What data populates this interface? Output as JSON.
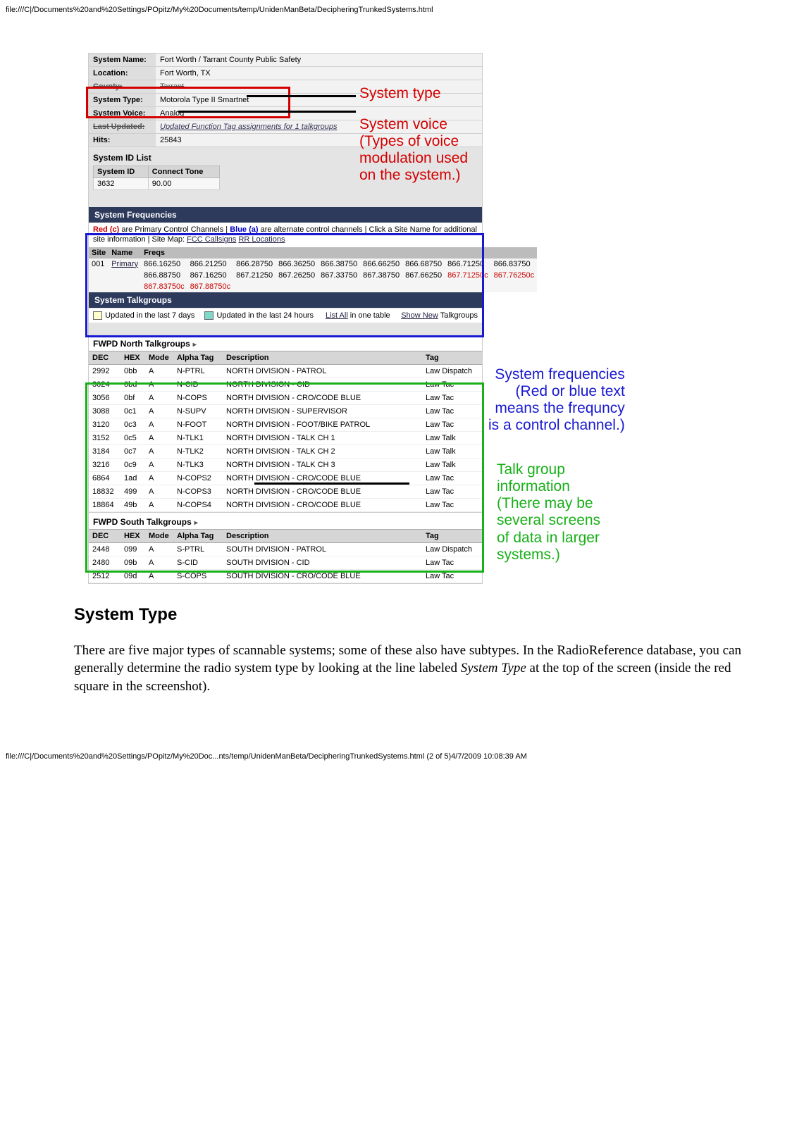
{
  "page": {
    "url_top": "file:///C|/Documents%20and%20Settings/POpitz/My%20Documents/temp/UnidenManBeta/DecipheringTrunkedSystems.html",
    "url_bottom": "file:///C|/Documents%20and%20Settings/POpitz/My%20Doc...nts/temp/UnidenManBeta/DecipheringTrunkedSystems.html (2 of 5)4/7/2009 10:08:39 AM"
  },
  "sysinfo": {
    "rows": [
      {
        "label": "System Name:",
        "value": "Fort Worth / Tarrant County Public Safety"
      },
      {
        "label": "Location:",
        "value": "Fort Worth, TX"
      },
      {
        "label": "County:",
        "value": "Tarrant",
        "struck": true
      },
      {
        "label": "System Type:",
        "value": "Motorola Type II Smartnet"
      },
      {
        "label": "System Voice:",
        "value": "Analog"
      },
      {
        "label": "Last Updated:",
        "value": "Updated Function Tag assignments for 1 talkgroups",
        "italic": true
      },
      {
        "label": "Hits:",
        "value": "25843"
      }
    ]
  },
  "sysid": {
    "heading": "System ID List",
    "headers": [
      "System ID",
      "Connect Tone"
    ],
    "row": [
      "3632",
      "90.00"
    ]
  },
  "freqs": {
    "bar": "System Frequencies",
    "legend_red": "Red (c)",
    "legend_red_rest": " are Primary Control Channels | ",
    "legend_blue": "Blue (a)",
    "legend_blue_rest": " are alternate control channels | Click a Site Name for additional site information | Site Map: ",
    "legend_link1": "FCC Callsigns",
    "legend_link2": "RR Locations",
    "headers": [
      "Site",
      "Name",
      "Freqs"
    ],
    "site": "001",
    "sitename": "Primary",
    "row1": [
      "866.16250",
      "866.21250",
      "866.28750",
      "866.36250",
      "866.38750",
      "866.66250",
      "866.68750",
      "866.71250",
      "866.83750"
    ],
    "row2": [
      "866.88750",
      "867.16250",
      "867.21250",
      "867.26250",
      "867.33750",
      "867.38750",
      "867.66250",
      "867.71250c",
      "867.76250c"
    ],
    "row3": [
      "867.83750c",
      "867.88750c"
    ]
  },
  "talkgroups": {
    "bar": "System Talkgroups",
    "legend_7d": "Updated in the last 7 days",
    "legend_24h": "Updated in the last 24 hours",
    "list_all_a": "List All",
    "list_all_b": " in one table",
    "show_new_a": "Show New",
    "show_new_b": " Talkgroups",
    "north": {
      "title": "FWPD North Talkgroups",
      "headers": [
        "DEC",
        "HEX",
        "Mode",
        "Alpha Tag",
        "Description",
        "Tag"
      ],
      "rows": [
        [
          "2992",
          "0bb",
          "A",
          "N-PTRL",
          "NORTH DIVISION - PATROL",
          "Law Dispatch"
        ],
        [
          "3024",
          "0bd",
          "A",
          "N-CID",
          "NORTH DIVISION - CID",
          "Law Tac"
        ],
        [
          "3056",
          "0bf",
          "A",
          "N-COPS",
          "NORTH DIVISION - CRO/CODE BLUE",
          "Law Tac"
        ],
        [
          "3088",
          "0c1",
          "A",
          "N-SUPV",
          "NORTH DIVISION - SUPERVISOR",
          "Law Tac"
        ],
        [
          "3120",
          "0c3",
          "A",
          "N-FOOT",
          "NORTH DIVISION - FOOT/BIKE PATROL",
          "Law Tac"
        ],
        [
          "3152",
          "0c5",
          "A",
          "N-TLK1",
          "NORTH DIVISION - TALK CH 1",
          "Law Talk"
        ],
        [
          "3184",
          "0c7",
          "A",
          "N-TLK2",
          "NORTH DIVISION - TALK CH 2",
          "Law Talk"
        ],
        [
          "3216",
          "0c9",
          "A",
          "N-TLK3",
          "NORTH DIVISION - TALK CH 3",
          "Law Talk"
        ],
        [
          "6864",
          "1ad",
          "A",
          "N-COPS2",
          "NORTH DIVISION - CRO/CODE BLUE",
          "Law Tac"
        ],
        [
          "18832",
          "499",
          "A",
          "N-COPS3",
          "NORTH DIVISION - CRO/CODE BLUE",
          "Law Tac"
        ],
        [
          "18864",
          "49b",
          "A",
          "N-COPS4",
          "NORTH DIVISION - CRO/CODE BLUE",
          "Law Tac"
        ]
      ]
    },
    "south": {
      "title": "FWPD South Talkgroups",
      "headers": [
        "DEC",
        "HEX",
        "Mode",
        "Alpha Tag",
        "Description",
        "Tag"
      ],
      "rows": [
        [
          "2448",
          "099",
          "A",
          "S-PTRL",
          "SOUTH DIVISION - PATROL",
          "Law Dispatch"
        ],
        [
          "2480",
          "09b",
          "A",
          "S-CID",
          "SOUTH DIVISION - CID",
          "Law Tac"
        ],
        [
          "2512",
          "09d",
          "A",
          "S-COPS",
          "SOUTH DIVISION - CRO/CODE BLUE",
          "Law Tac"
        ]
      ]
    }
  },
  "callouts": {
    "red1": "System type",
    "red2": "System voice\n(Types of voice\nmodulation used\non the system.)",
    "blue": "System frequencies\n(Red or blue text\nmeans the frequncy\nis a control channel.)",
    "green": "Talk group\ninformation\n(There may be\nseveral screens\nof data in larger\nsystems.)"
  },
  "prose": {
    "heading": "System Type",
    "p1a": "There are five major types of scannable systems; some of these also have subtypes. In the RadioReference database, you can generally determine the radio system type by looking at the line labeled ",
    "p1em": "System Type",
    "p1b": " at the top of the screen (inside the red square in the screenshot)."
  }
}
